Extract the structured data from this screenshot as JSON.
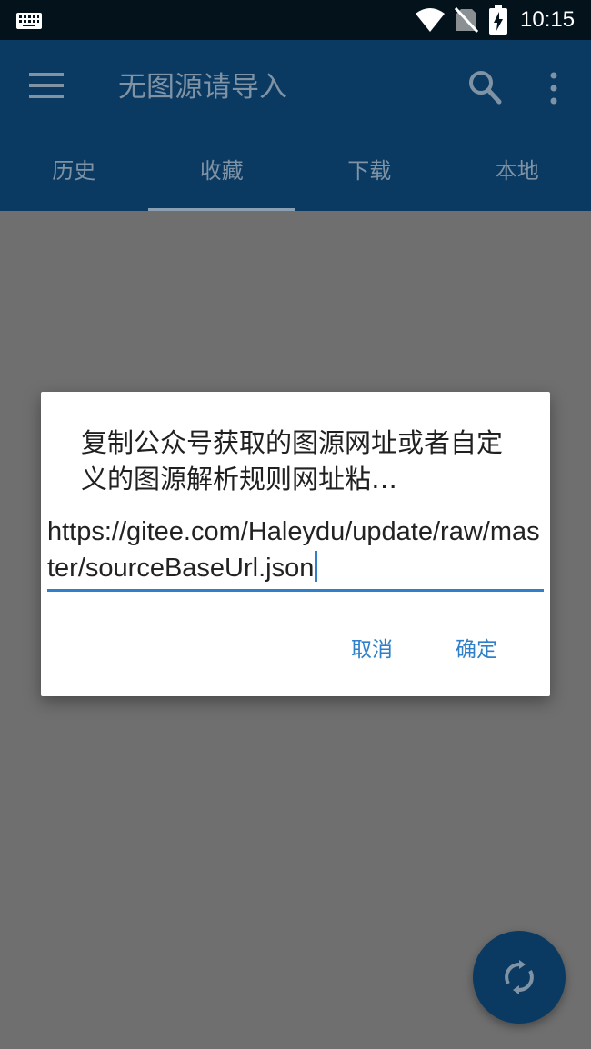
{
  "status_bar": {
    "time": "10:15"
  },
  "app_bar": {
    "title": "无图源请导入"
  },
  "tabs": [
    {
      "label": "历史"
    },
    {
      "label": "收藏"
    },
    {
      "label": "下载"
    },
    {
      "label": "本地"
    }
  ],
  "dialog": {
    "message": "复制公众号获取的图源网址或者自定义的图源解析规则网址粘…",
    "input_value": "https://gitee.com/Haleydu/update/raw/master/sourceBaseUrl.json",
    "cancel_label": "取消",
    "ok_label": "确定"
  },
  "colors": {
    "primary": "#0a3a62",
    "accent": "#2f80c8",
    "status_bar": "#04121c",
    "scrim_background": "#6f6f6f"
  },
  "icons": {
    "keyboard": "keyboard-icon",
    "wifi": "wifi-icon",
    "no_sim": "no-sim-icon",
    "battery": "battery-charging-icon",
    "menu": "menu-icon",
    "search": "search-icon",
    "more": "more-vert-icon",
    "refresh": "sync-icon"
  }
}
